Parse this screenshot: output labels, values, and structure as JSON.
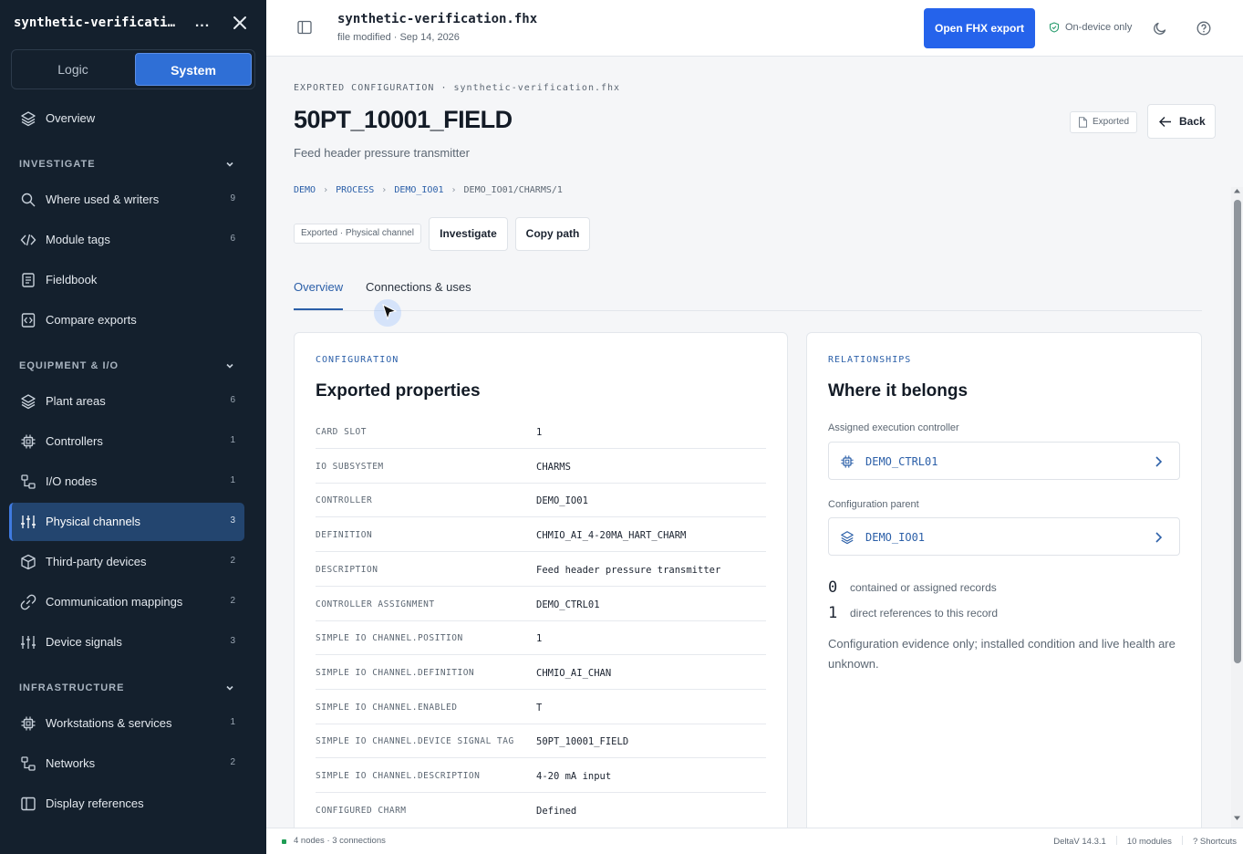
{
  "sidebar": {
    "title": "synthetic-verification.fhx",
    "more_label": "...",
    "segments": {
      "logic": "Logic",
      "system": "System"
    },
    "overview": {
      "label": "Overview"
    },
    "sections": {
      "investigate": {
        "title": "INVESTIGATE"
      },
      "equipment": {
        "title": "EQUIPMENT & I/O"
      },
      "infrastructure": {
        "title": "INFRASTRUCTURE"
      }
    },
    "investigate_items": [
      {
        "label": "Where used & writers",
        "count": "9",
        "icon": "search-icon"
      },
      {
        "label": "Module tags",
        "count": "6",
        "icon": "code-icon"
      },
      {
        "label": "Fieldbook",
        "count": "",
        "icon": "notebook-icon"
      },
      {
        "label": "Compare exports",
        "count": "",
        "icon": "compare-icon"
      }
    ],
    "equipment_items": [
      {
        "label": "Plant areas",
        "count": "6",
        "icon": "layers-icon"
      },
      {
        "label": "Controllers",
        "count": "1",
        "icon": "chip-icon"
      },
      {
        "label": "I/O nodes",
        "count": "1",
        "icon": "nodes-icon"
      },
      {
        "label": "Physical channels",
        "count": "3",
        "icon": "sliders-icon"
      },
      {
        "label": "Third-party devices",
        "count": "2",
        "icon": "box-icon"
      },
      {
        "label": "Communication mappings",
        "count": "2",
        "icon": "link-icon"
      },
      {
        "label": "Device signals",
        "count": "3",
        "icon": "sliders-icon"
      }
    ],
    "infrastructure_items": [
      {
        "label": "Workstations & services",
        "count": "1",
        "icon": "chip-icon"
      },
      {
        "label": "Networks",
        "count": "2",
        "icon": "nodes-icon"
      },
      {
        "label": "Display references",
        "count": "",
        "icon": "panel-icon"
      }
    ]
  },
  "topbar": {
    "file_name": "synthetic-verification.fhx",
    "file_meta": "file modified · Sep 14, 2026",
    "open_button": "Open FHX export",
    "privacy_badge": "On-device only"
  },
  "page": {
    "eyebrow": "EXPORTED CONFIGURATION · synthetic-verification.fhx",
    "title": "50PT_10001_FIELD",
    "description": "Feed header pressure transmitter",
    "exported_pill": "Exported",
    "back_button": "Back",
    "breadcrumb": [
      "DEMO",
      "PROCESS",
      "DEMO_IO01",
      "DEMO_IO01/CHARMS/1"
    ],
    "breadcrumb_sep": "›",
    "tag_chip": "Exported · Physical channel",
    "actions": {
      "investigate": "Investigate",
      "copy_path": "Copy path"
    },
    "tabs": [
      "Overview",
      "Connections & uses"
    ]
  },
  "configuration": {
    "eyebrow": "CONFIGURATION",
    "title": "Exported properties",
    "rows": [
      {
        "key": "CARD SLOT",
        "value": "1"
      },
      {
        "key": "IO SUBSYSTEM",
        "value": "CHARMS"
      },
      {
        "key": "CONTROLLER",
        "value": "DEMO_IO01"
      },
      {
        "key": "DEFINITION",
        "value": "CHMIO_AI_4-20MA_HART_CHARM"
      },
      {
        "key": "DESCRIPTION",
        "value": "Feed header pressure transmitter"
      },
      {
        "key": "CONTROLLER ASSIGNMENT",
        "value": "DEMO_CTRL01"
      },
      {
        "key": "SIMPLE IO CHANNEL.POSITION",
        "value": "1"
      },
      {
        "key": "SIMPLE IO CHANNEL.DEFINITION",
        "value": "CHMIO_AI_CHAN"
      },
      {
        "key": "SIMPLE IO CHANNEL.ENABLED",
        "value": "T"
      },
      {
        "key": "SIMPLE IO CHANNEL.DEVICE SIGNAL TAG",
        "value": "50PT_10001_FIELD"
      },
      {
        "key": "SIMPLE IO CHANNEL.DESCRIPTION",
        "value": "4-20 mA input"
      },
      {
        "key": "CONFIGURED CHARM",
        "value": "Defined"
      }
    ]
  },
  "relationships": {
    "eyebrow": "RELATIONSHIPS",
    "title": "Where it belongs",
    "controller_label": "Assigned execution controller",
    "controller_value": "DEMO_CTRL01",
    "parent_label": "Configuration parent",
    "parent_value": "DEMO_IO01",
    "stats": [
      {
        "num": "0",
        "text": "contained or assigned records"
      },
      {
        "num": "1",
        "text": "direct references to this record"
      }
    ],
    "note": "Configuration evidence only; installed condition and live health are unknown."
  },
  "statusbar": {
    "left": "4 nodes · 3 connections",
    "version": "DeltaV 14.3.1",
    "modules": "10 modules",
    "shortcuts": "? Shortcuts"
  },
  "colors": {
    "sidebar_bg": "#14202d",
    "accent": "#2563eb",
    "link": "#2b5fa8",
    "active_nav": "#23456f"
  }
}
